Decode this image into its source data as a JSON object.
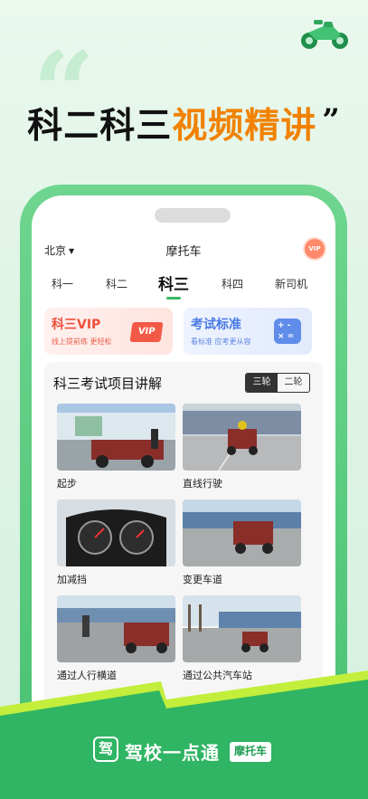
{
  "hero": {
    "headline_black": "科二科三",
    "headline_orange": "视频精讲",
    "quote_open": "“",
    "quote_close": "”"
  },
  "app": {
    "city": "北京",
    "title": "摩托车",
    "vip_badge": "VIP",
    "tabs": [
      "科一",
      "科二",
      "科三",
      "科四",
      "新司机"
    ],
    "active_tab": 2
  },
  "cards": [
    {
      "title": "科三VIP",
      "subtitle": "线上提前练 更轻松",
      "icon_text": "VIP"
    },
    {
      "title": "考试标准",
      "subtitle": "看标准 应考更从容",
      "icon_text": "+ -\n× ="
    }
  ],
  "section": {
    "title": "科三考试项目讲解",
    "toggle": [
      "三轮",
      "二轮"
    ],
    "toggle_selected": 0,
    "items": [
      {
        "label": "起步"
      },
      {
        "label": "直线行驶"
      },
      {
        "label": "加减挡"
      },
      {
        "label": "变更车道"
      },
      {
        "label": "通过人行横道"
      },
      {
        "label": "通过公共汽车站"
      }
    ]
  },
  "footer": {
    "logo_char": "驾",
    "brand": "驾校一点通",
    "tag": "摩托车"
  },
  "colors": {
    "brand_green": "#2fb563",
    "accent_orange": "#f08200",
    "vip_red": "#f0503c",
    "standard_blue": "#4a79e4"
  }
}
